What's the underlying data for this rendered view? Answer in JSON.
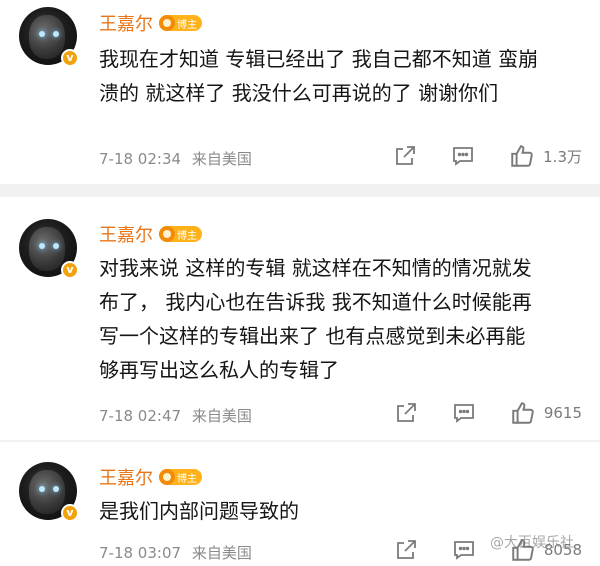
{
  "comments": [
    {
      "author": "王嘉尔",
      "badge": "博主",
      "text_lines": [
        "我现在才知道 专辑已经出了 我自己都不知道 蛮崩",
        "溃的  就这样了 我没什么可再说的了  谢谢你们"
      ],
      "time": "7-18 02:34",
      "location": "来自美国",
      "likes": "1.3万"
    },
    {
      "author": "王嘉尔",
      "badge": "博主",
      "text_lines": [
        "对我来说 这样的专辑 就这样在不知情的情况就发",
        "布了，  我内心也在告诉我 我不知道什么时候能再",
        "写一个这样的专辑出来了 也有点感觉到未必再能",
        "够再写出这么私人的专辑了"
      ],
      "time": "7-18 02:47",
      "location": "来自美国",
      "likes": "9615"
    },
    {
      "author": "王嘉尔",
      "badge": "博主",
      "text_lines": [
        "是我们内部问题导致的"
      ],
      "time": "7-18 03:07",
      "location": "来自美国",
      "likes": "8058"
    }
  ],
  "watermark": "@大百娱乐社",
  "colors": {
    "name": "#e8761a",
    "badge": "#ffb21a",
    "meta": "#8a8a8a",
    "divider": "#f1f1f1"
  },
  "icons": [
    "share-icon",
    "comment-icon",
    "like-icon",
    "verified-v-badge"
  ]
}
